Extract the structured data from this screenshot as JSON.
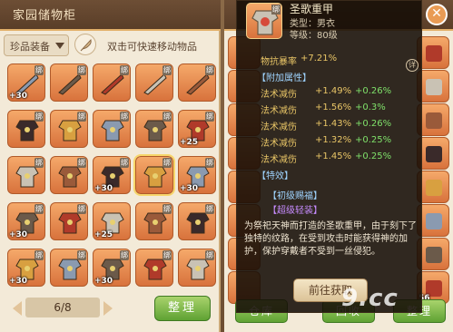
{
  "left": {
    "title": "家园储物柜",
    "category": "珍品装备",
    "hint": "双击可快速移动物品",
    "pager": {
      "current": "6/8"
    },
    "sort_button": "整理",
    "slots": [
      {
        "bind": "绑",
        "qty": "+30"
      },
      {
        "bind": "绑",
        "qty": ""
      },
      {
        "bind": "绑",
        "qty": ""
      },
      {
        "bind": "绑",
        "qty": ""
      },
      {
        "bind": "绑",
        "qty": ""
      },
      {
        "bind": "绑",
        "qty": ""
      },
      {
        "bind": "绑",
        "qty": ""
      },
      {
        "bind": "绑",
        "qty": ""
      },
      {
        "bind": "绑",
        "qty": ""
      },
      {
        "bind": "绑",
        "qty": "+25"
      },
      {
        "bind": "绑",
        "qty": ""
      },
      {
        "bind": "绑",
        "qty": ""
      },
      {
        "bind": "绑",
        "qty": "+30"
      },
      {
        "bind": "绑",
        "qty": ""
      },
      {
        "bind": "绑",
        "qty": "+30"
      },
      {
        "bind": "绑",
        "qty": "+30"
      },
      {
        "bind": "绑",
        "qty": ""
      },
      {
        "bind": "",
        "qty": "+25"
      },
      {
        "bind": "绑",
        "qty": ""
      },
      {
        "bind": "绑",
        "qty": ""
      },
      {
        "bind": "绑",
        "qty": "+30"
      },
      {
        "bind": "绑",
        "qty": ""
      },
      {
        "bind": "绑",
        "qty": "+30"
      },
      {
        "bind": "绑",
        "qty": ""
      },
      {
        "bind": "绑",
        "qty": ""
      }
    ]
  },
  "right": {
    "bottom_buttons": [
      "仓库",
      "回收",
      "整理"
    ],
    "slot_counts": [
      "",
      "",
      "",
      "",
      "",
      "",
      "",
      "56"
    ]
  },
  "tooltip": {
    "name": "圣歌重甲",
    "type": "类型：男衣",
    "level": "等级：80级",
    "bind": "绑",
    "crit_label": "物抗暴率",
    "crit_value": "+7.21%",
    "extra_header": "【附加属性】",
    "extras": [
      {
        "k": "法术减伤",
        "v1": "+1.49%",
        "v2": "+0.26%"
      },
      {
        "k": "法术减伤",
        "v1": "+1.56%",
        "v2": "+0.3%"
      },
      {
        "k": "法术减伤",
        "v1": "+1.43%",
        "v2": "+0.26%"
      },
      {
        "k": "法术减伤",
        "v1": "+1.32%",
        "v2": "+0.25%"
      },
      {
        "k": "法术减伤",
        "v1": "+1.45%",
        "v2": "+0.25%"
      }
    ],
    "special_header": "【特效】",
    "special_1": "【初级赐福】",
    "special_2": "【超级轻装】",
    "description": "为祭祀天神而打造的圣歌重甲，由于刻下了独特的纹路，在受到攻击时能获得神的加护，保护穿戴者不受到一丝侵犯。",
    "detail_button": "前往获取",
    "detail_icon": "详"
  },
  "watermark": "9.cc",
  "colors": {
    "slot_orange": "#e38a4c",
    "panel_bg": "#f3ead8",
    "accent_green": "#5fa233",
    "gold_text": "#e8c566",
    "green_text": "#7fe06a"
  }
}
